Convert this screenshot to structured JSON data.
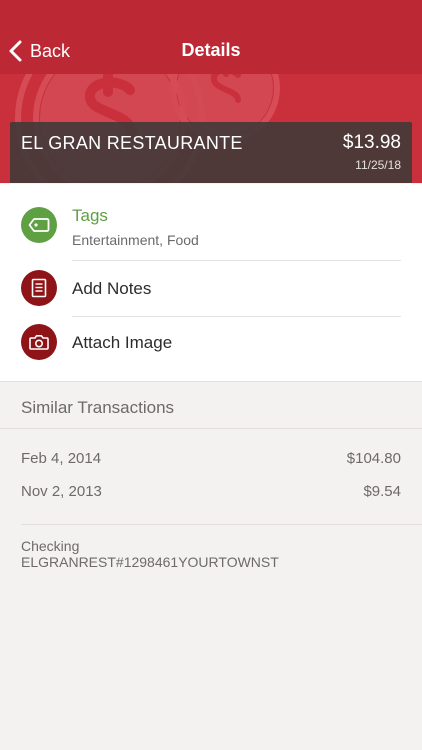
{
  "nav": {
    "back_label": "Back",
    "title": "Details"
  },
  "colors": {
    "brand_red": "#bc2834",
    "tags_green": "#5fa043",
    "icon_dark_red": "#8f1418",
    "merchant_bar": "#403a38"
  },
  "transaction": {
    "merchant": "EL GRAN RESTAURANTE",
    "amount": "$13.98",
    "date": "11/25/18"
  },
  "actions": [
    {
      "label": "Tags",
      "sub": "Entertainment, Food",
      "icon": "tag-icon"
    },
    {
      "label": "Add Notes",
      "icon": "notes-icon"
    },
    {
      "label": "Attach Image",
      "icon": "camera-icon"
    }
  ],
  "similar": {
    "title": "Similar Transactions",
    "rows": [
      {
        "date": "Feb 4, 2014",
        "amount": "$104.80"
      },
      {
        "date": "Nov 2, 2013",
        "amount": "$9.54"
      }
    ]
  },
  "account": {
    "name": "Checking",
    "description": "ELGRANREST#1298461YOURTOWNST"
  }
}
